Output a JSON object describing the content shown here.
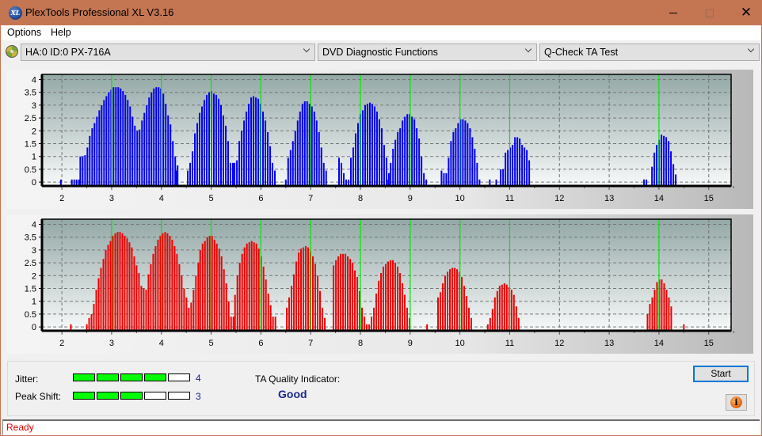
{
  "window": {
    "title": "PlexTools Professional XL V3.16",
    "app_icon_text": "XL",
    "controls": [
      "minimize",
      "maximize",
      "close"
    ]
  },
  "menu": {
    "items": [
      {
        "label": "Options"
      },
      {
        "label": "Help"
      }
    ]
  },
  "toolbar": {
    "drive_select": {
      "value": "HA:0 ID:0  PX-716A"
    },
    "function_select": {
      "value": "DVD Diagnostic Functions"
    },
    "test_select": {
      "value": "Q-Check TA Test"
    }
  },
  "colors": {
    "titlebar": "#c47552",
    "bar_top": "#0000ee",
    "bar_bottom": "#ee0000",
    "marker": "#00ee00",
    "meter_on": "#00ff00",
    "status_text": "#e00000",
    "quality_text": "#1a2a8e"
  },
  "chart_data": [
    {
      "type": "bar",
      "title": "",
      "series_name": "Lands / Pits (top)",
      "xlabel": "",
      "ylabel": "",
      "xlim": [
        1.6,
        15.45
      ],
      "ylim": [
        -0.15,
        4.2
      ],
      "x_ticks": [
        "2",
        "3",
        "4",
        "5",
        "6",
        "7",
        "8",
        "9",
        "10",
        "11",
        "12",
        "13",
        "14",
        "15"
      ],
      "y_ticks": [
        "0",
        "0.5",
        "1",
        "1.5",
        "2",
        "2.5",
        "3",
        "3.5",
        "4"
      ],
      "grid": true,
      "marker_lines_x": [
        3,
        4,
        5,
        6,
        7,
        8,
        9,
        10,
        11,
        14
      ],
      "bar_step": 0.0477,
      "segments": [
        {
          "start": 1.98,
          "values": [
            0.1
          ]
        },
        {
          "start": 2.2,
          "values": [
            0.1,
            0.1,
            0.1,
            0.1
          ]
        },
        {
          "start": 2.37,
          "values": [
            1.0,
            1.0,
            1.05,
            1.35,
            1.8,
            2.1,
            2.3,
            2.55,
            2.8,
            3.0,
            3.2,
            3.35,
            3.5,
            3.6,
            3.7,
            3.7,
            3.7,
            3.65,
            3.55,
            3.4,
            3.2,
            2.95,
            2.55,
            2.2,
            2.0,
            2.05,
            2.4,
            2.7,
            3.0,
            3.3,
            3.5,
            3.65,
            3.7,
            3.7,
            3.65,
            3.45,
            3.05,
            2.6,
            2.25,
            1.6,
            1.0,
            0.65
          ]
        },
        {
          "start": 4.3,
          "values": [
            0.45
          ]
        },
        {
          "start": 4.53,
          "values": [
            0.45,
            0.75,
            1.2,
            1.9,
            2.3,
            2.7,
            2.95,
            3.2,
            3.4,
            3.5,
            3.55,
            3.45,
            3.4,
            3.25,
            3.0,
            2.6,
            2.2,
            1.6,
            0.75,
            0.75
          ]
        },
        {
          "start": 5.47,
          "values": [
            0.75,
            0.85,
            1.6,
            2.0,
            2.4,
            2.75,
            3.05,
            3.3,
            3.35,
            3.3,
            3.25,
            3.05,
            2.75,
            2.4,
            1.95,
            1.4,
            0.75,
            0.45
          ]
        },
        {
          "start": 6.5,
          "values": [
            0.1,
            0.95,
            1.25,
            1.6,
            2.0,
            2.4,
            2.75,
            3.05,
            3.15,
            3.15,
            3.05,
            2.95,
            2.75,
            2.4,
            1.95,
            1.35,
            0.75,
            0.45
          ]
        },
        {
          "start": 7.57,
          "values": [
            0.95,
            0.75,
            0.35,
            0.1,
            0.1,
            0.95,
            1.35,
            1.9,
            2.3,
            2.65,
            2.8,
            3.0,
            3.05,
            3.1,
            3.05,
            2.95,
            2.75,
            2.45,
            2.1,
            1.45,
            0.95,
            0.35
          ]
        },
        {
          "start": 8.56,
          "values": [
            0.1,
            0.75,
            1.3,
            1.65,
            1.95,
            2.1,
            2.4,
            2.55,
            2.65,
            2.65,
            2.55,
            2.45,
            2.1,
            1.7,
            1.0,
            0.35,
            0.1
          ]
        },
        {
          "start": 9.63,
          "values": [
            0.45,
            0.35,
            0.35,
            0.95,
            1.6,
            1.95,
            2.1,
            2.3,
            2.45,
            2.45,
            2.4,
            2.3,
            2.1,
            1.75,
            1.3,
            0.75,
            0.1
          ]
        },
        {
          "start": 10.6,
          "values": [
            0.1
          ]
        },
        {
          "start": 10.73,
          "values": [
            0.1
          ]
        },
        {
          "start": 10.82,
          "values": [
            0.5,
            0.5,
            1.15,
            1.25,
            1.35,
            1.45,
            1.75,
            1.75,
            1.7,
            1.45,
            1.35,
            1.25,
            0.85
          ]
        },
        {
          "start": 13.7,
          "values": [
            0.1,
            0.1
          ]
        },
        {
          "start": 13.86,
          "values": [
            0.6,
            1.15,
            1.45,
            1.65,
            1.85,
            1.8,
            1.75,
            1.6,
            1.2,
            0.7,
            0.3
          ]
        }
      ]
    },
    {
      "type": "bar",
      "title": "",
      "series_name": "Lands / Pits (bottom)",
      "xlabel": "",
      "ylabel": "",
      "xlim": [
        1.6,
        15.45
      ],
      "ylim": [
        -0.15,
        4.2
      ],
      "x_ticks": [
        "2",
        "3",
        "4",
        "5",
        "6",
        "7",
        "8",
        "9",
        "10",
        "11",
        "12",
        "13",
        "14",
        "15"
      ],
      "y_ticks": [
        "0",
        "0.5",
        "1",
        "1.5",
        "2",
        "2.5",
        "3",
        "3.5",
        "4"
      ],
      "grid": true,
      "marker_lines_x": [
        3,
        4,
        5,
        6,
        7,
        8,
        9,
        10,
        11,
        14
      ],
      "bar_step": 0.0477,
      "segments": [
        {
          "start": 2.18,
          "values": [
            0.1
          ]
        },
        {
          "start": 2.5,
          "values": [
            0.1,
            0.35,
            0.5,
            0.9,
            1.45,
            1.9,
            2.3,
            2.65,
            3.0,
            3.2,
            3.35,
            3.55,
            3.65,
            3.7,
            3.7,
            3.65,
            3.55,
            3.45,
            3.3,
            3.1,
            2.75,
            2.4,
            2.1,
            1.6,
            1.5,
            1.45,
            2.05,
            2.45,
            2.85,
            3.15,
            3.4,
            3.55,
            3.65,
            3.7,
            3.65,
            3.55,
            3.4,
            3.15,
            2.85,
            2.45,
            2.0,
            1.5,
            1.15,
            0.75,
            0.95,
            1.45,
            2.0,
            2.5
          ]
        },
        {
          "start": 4.78,
          "values": [
            3.0,
            3.25,
            3.35,
            3.5,
            3.55,
            3.55,
            3.4,
            3.25,
            3.05,
            2.75,
            2.25,
            1.7,
            1.0,
            0.4,
            0.4
          ]
        },
        {
          "start": 5.48,
          "values": [
            1.25,
            2.0,
            2.5,
            2.85,
            3.1,
            3.25,
            3.3,
            3.35,
            3.3,
            3.25,
            3.05,
            2.75,
            2.35,
            1.85,
            1.3,
            0.85,
            0.4,
            0.4
          ]
        },
        {
          "start": 6.52,
          "values": [
            0.75,
            1.15,
            1.6,
            2.05,
            2.55,
            2.9,
            3.05,
            3.1,
            3.15,
            3.1,
            2.95,
            2.75,
            2.45,
            2.0,
            1.4,
            0.75,
            0.35
          ]
        },
        {
          "start": 7.46,
          "values": [
            2.4,
            2.6,
            2.75,
            2.85,
            2.85,
            2.85,
            2.75,
            2.65,
            2.5,
            2.2,
            1.95,
            1.4,
            0.75,
            0.4,
            0.1,
            0.1,
            0.4,
            0.75,
            1.3,
            1.8,
            2.1,
            2.35,
            2.45,
            2.55,
            2.6,
            2.6,
            2.5,
            2.35,
            2.1,
            1.7,
            1.25,
            0.75,
            0.35
          ]
        },
        {
          "start": 9.34,
          "values": [
            0.1
          ]
        },
        {
          "start": 9.56,
          "values": [
            1.15,
            1.35,
            1.7,
            2.0,
            2.15,
            2.25,
            2.3,
            2.3,
            2.25,
            2.15,
            1.95,
            1.6,
            1.2,
            0.75,
            0.35
          ]
        },
        {
          "start": 10.56,
          "values": [
            0.1,
            0.35,
            0.7,
            1.15,
            1.4,
            1.6,
            1.65,
            1.7,
            1.65,
            1.55,
            1.45,
            1.25,
            0.8,
            0.35
          ]
        },
        {
          "start": 13.77,
          "values": [
            0.5,
            0.9,
            1.15,
            1.45,
            1.75,
            1.85,
            1.85,
            1.7,
            1.45,
            1.15,
            0.8
          ]
        },
        {
          "start": 14.5,
          "values": [
            0.1
          ]
        }
      ]
    }
  ],
  "results": {
    "jitter": {
      "label": "Jitter:",
      "value": "4",
      "level": 4,
      "max": 5
    },
    "peak_shift": {
      "label": "Peak Shift:",
      "value": "3",
      "level": 3,
      "max": 5
    },
    "ta_quality": {
      "label": "TA Quality Indicator:",
      "value": "Good"
    }
  },
  "buttons": {
    "start": "Start",
    "info_icon": "i"
  },
  "status": {
    "text": "Ready"
  }
}
